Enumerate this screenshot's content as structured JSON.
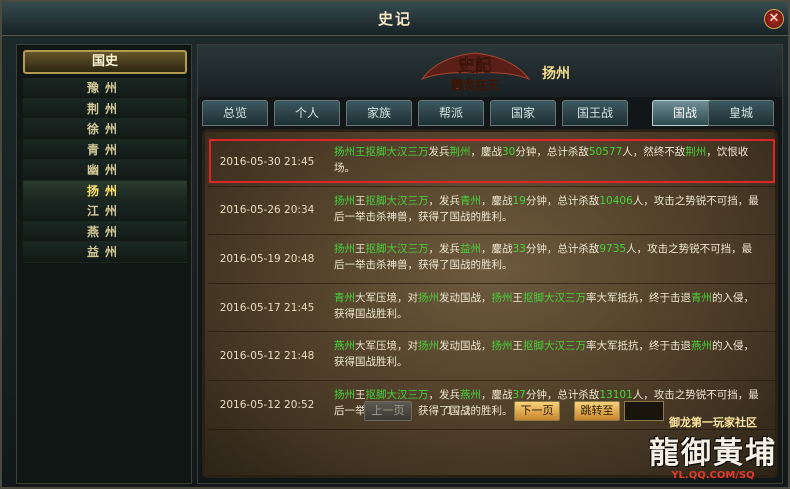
{
  "window": {
    "title": "史记",
    "close_glyph": "✕",
    "accent_color": "#e0252a"
  },
  "sidebar": {
    "header": "国史",
    "regions": [
      "豫州",
      "荆州",
      "徐州",
      "青州",
      "幽州",
      "扬州",
      "江州",
      "燕州",
      "益州"
    ],
    "active_index": 5
  },
  "banner": {
    "logo_top": "史記",
    "logo_bottom": "御龙在天",
    "region": "扬州"
  },
  "tabs": [
    {
      "label": "总览"
    },
    {
      "label": "个人"
    },
    {
      "label": "家族"
    },
    {
      "label": "帮派"
    },
    {
      "label": "国家"
    },
    {
      "label": "国王战"
    },
    {
      "label": "国战"
    },
    {
      "label": "皇城"
    }
  ],
  "active_tab": 6,
  "records": [
    {
      "date": "2016-05-30 21:45",
      "segments": [
        {
          "text": "扬州王抠脚大汉三万",
          "g": true
        },
        {
          "text": "发兵",
          "g": false
        },
        {
          "text": "荆州",
          "g": true
        },
        {
          "text": "，鏖战",
          "g": false
        },
        {
          "text": "30",
          "g": true
        },
        {
          "text": "分钟，总计杀敌",
          "g": false
        },
        {
          "text": "50577",
          "g": true
        },
        {
          "text": "人，然终不敌",
          "g": false
        },
        {
          "text": "荆州",
          "g": true
        },
        {
          "text": "，饮恨收场。",
          "g": false
        }
      ]
    },
    {
      "date": "2016-05-26 20:34",
      "segments": [
        {
          "text": "扬州",
          "g": true
        },
        {
          "text": "王",
          "g": false
        },
        {
          "text": "抠脚大汉三万",
          "g": true
        },
        {
          "text": "，发兵",
          "g": false
        },
        {
          "text": "青州",
          "g": true
        },
        {
          "text": "，鏖战",
          "g": false
        },
        {
          "text": "19",
          "g": true
        },
        {
          "text": "分钟，总计杀敌",
          "g": false
        },
        {
          "text": "10406",
          "g": true
        },
        {
          "text": "人，攻击之势锐不可挡，最后一举击杀神兽，获得了国战的胜利。",
          "g": false
        }
      ]
    },
    {
      "date": "2016-05-19 20:48",
      "segments": [
        {
          "text": "扬州",
          "g": true
        },
        {
          "text": "王",
          "g": false
        },
        {
          "text": "抠脚大汉三万",
          "g": true
        },
        {
          "text": "，发兵",
          "g": false
        },
        {
          "text": "益州",
          "g": true
        },
        {
          "text": "，鏖战",
          "g": false
        },
        {
          "text": "33",
          "g": true
        },
        {
          "text": "分钟，总计杀敌",
          "g": false
        },
        {
          "text": "9735",
          "g": true
        },
        {
          "text": "人，攻击之势锐不可挡，最后一举击杀神兽，获得了国战的胜利。",
          "g": false
        }
      ]
    },
    {
      "date": "2016-05-17 21:45",
      "segments": [
        {
          "text": "青州",
          "g": true
        },
        {
          "text": "大军压境，对",
          "g": false
        },
        {
          "text": "扬州",
          "g": true
        },
        {
          "text": "发动国战，",
          "g": false
        },
        {
          "text": "扬州",
          "g": true
        },
        {
          "text": "王",
          "g": false
        },
        {
          "text": "抠脚大汉三万",
          "g": true
        },
        {
          "text": "率大军抵抗，终于击退",
          "g": false
        },
        {
          "text": "青州",
          "g": true
        },
        {
          "text": "的入侵，获得国战胜利。",
          "g": false
        }
      ]
    },
    {
      "date": "2016-05-12 21:48",
      "segments": [
        {
          "text": "燕州",
          "g": true
        },
        {
          "text": "大军压境，对",
          "g": false
        },
        {
          "text": "扬州",
          "g": true
        },
        {
          "text": "发动国战，",
          "g": false
        },
        {
          "text": "扬州",
          "g": true
        },
        {
          "text": "王",
          "g": false
        },
        {
          "text": "抠脚大汉三万",
          "g": true
        },
        {
          "text": "率大军抵抗，终于击退",
          "g": false
        },
        {
          "text": "燕州",
          "g": true
        },
        {
          "text": "的入侵，获得国战胜利。",
          "g": false
        }
      ]
    },
    {
      "date": "2016-05-12 20:52",
      "segments": [
        {
          "text": "扬州",
          "g": true
        },
        {
          "text": "王",
          "g": false
        },
        {
          "text": "抠脚大汉三万",
          "g": true
        },
        {
          "text": "，发兵",
          "g": false
        },
        {
          "text": "燕州",
          "g": true
        },
        {
          "text": "，鏖战",
          "g": false
        },
        {
          "text": "37",
          "g": true
        },
        {
          "text": "分钟，总计杀敌",
          "g": false
        },
        {
          "text": "13101",
          "g": true
        },
        {
          "text": "人，攻击之势锐不可挡，最后一举击杀神兽，获得了国战的胜利。",
          "g": false
        }
      ]
    }
  ],
  "highlighted_index": 0,
  "pagination": {
    "prev": "上一页",
    "indicator": "1 / 2",
    "next": "下一页",
    "jump": "跳转至"
  },
  "watermark": {
    "line1": "御龙第一玩家社区",
    "logo": "龍御黃埔",
    "url": "YL.QQ.COM/SQ"
  }
}
